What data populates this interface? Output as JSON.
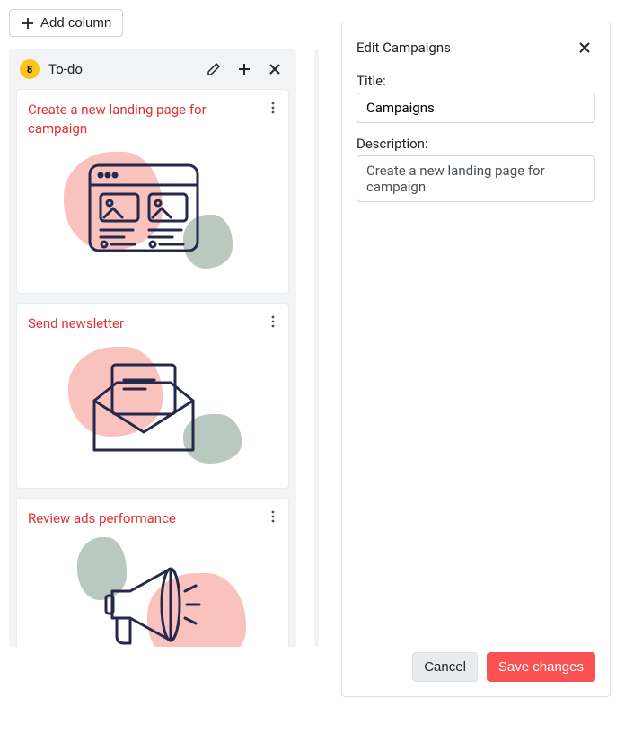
{
  "toolbar": {
    "add_column_label": "Add column"
  },
  "columns": [
    {
      "badge": "8",
      "badge_class": "",
      "title": "To-do",
      "cards": [
        {
          "title": "Create a new landing page for campaign",
          "art": "browser"
        },
        {
          "title": "Send newsletter",
          "art": "envelope"
        },
        {
          "title": "Review ads performance",
          "art": "megaphone"
        }
      ]
    }
  ],
  "next_column_badge_class": "green",
  "edit_panel": {
    "header": "Edit Campaigns",
    "title_label": "Title:",
    "title_value": "Campaigns",
    "description_label": "Description:",
    "description_value": "Create a new landing page for campaign",
    "cancel_label": "Cancel",
    "save_label": "Save changes"
  }
}
